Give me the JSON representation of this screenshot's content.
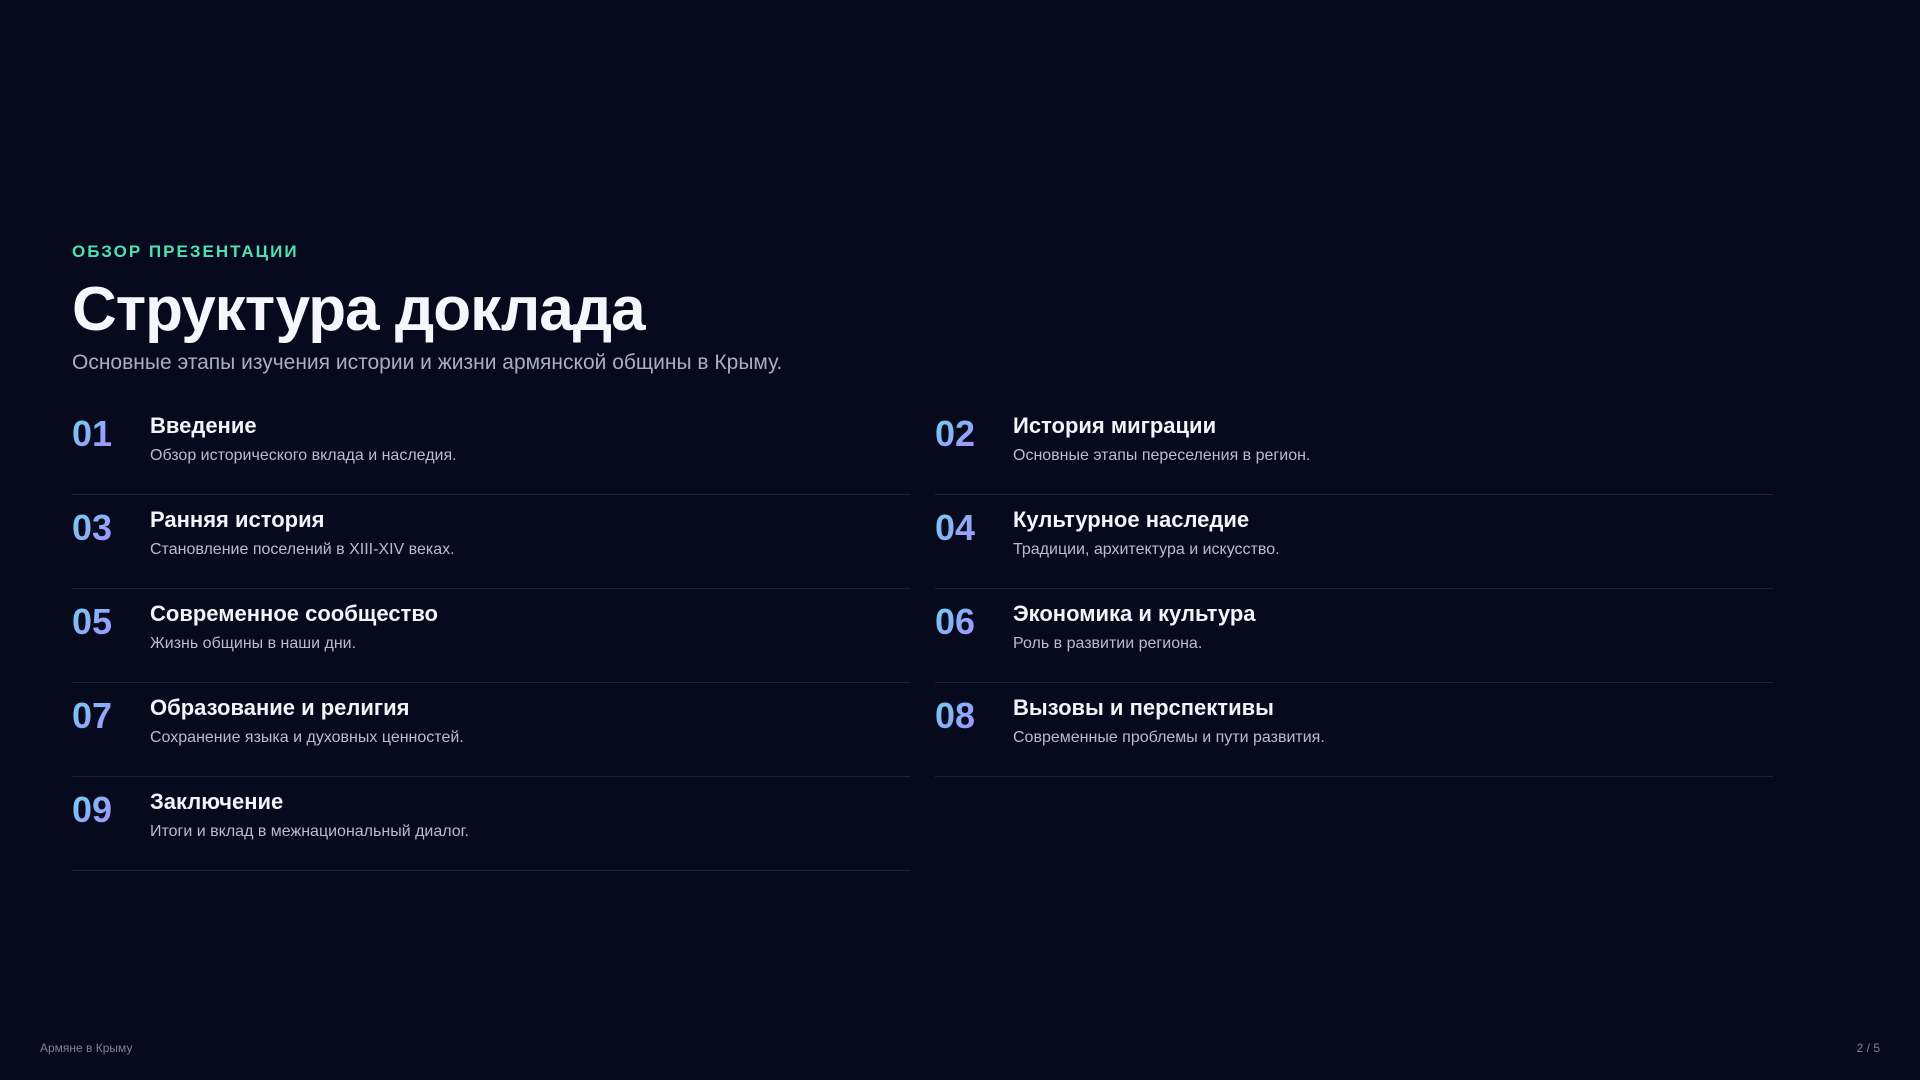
{
  "header": {
    "eyebrow": "ОБЗОР ПРЕЗЕНТАЦИИ",
    "title": "Структура доклада",
    "subtitle": "Основные этапы изучения истории и жизни армянской общины в Крыму."
  },
  "items": [
    {
      "num": "01",
      "title": "Введение",
      "desc": "Обзор исторического вклада и наследия."
    },
    {
      "num": "02",
      "title": "История миграции",
      "desc": "Основные этапы переселения в регион."
    },
    {
      "num": "03",
      "title": "Ранняя история",
      "desc": "Становление поселений в XIII-XIV веках."
    },
    {
      "num": "04",
      "title": "Культурное наследие",
      "desc": "Традиции, архитектура и искусство."
    },
    {
      "num": "05",
      "title": "Современное сообщество",
      "desc": "Жизнь общины в наши дни."
    },
    {
      "num": "06",
      "title": "Экономика и культура",
      "desc": "Роль в развитии региона."
    },
    {
      "num": "07",
      "title": "Образование и религия",
      "desc": "Сохранение языка и духовных ценностей."
    },
    {
      "num": "08",
      "title": "Вызовы и перспективы",
      "desc": "Современные проблемы и пути развития."
    },
    {
      "num": "09",
      "title": "Заключение",
      "desc": "Итоги и вклад в межнациональный диалог."
    }
  ],
  "footer": {
    "left": "Армяне в Крыму",
    "right": "2 / 5"
  },
  "colors": {
    "background": "#070a1c",
    "accent": "#4fe0b0",
    "number_gradient_start": "#6fd2ee",
    "number_gradient_end": "#a58dff"
  }
}
